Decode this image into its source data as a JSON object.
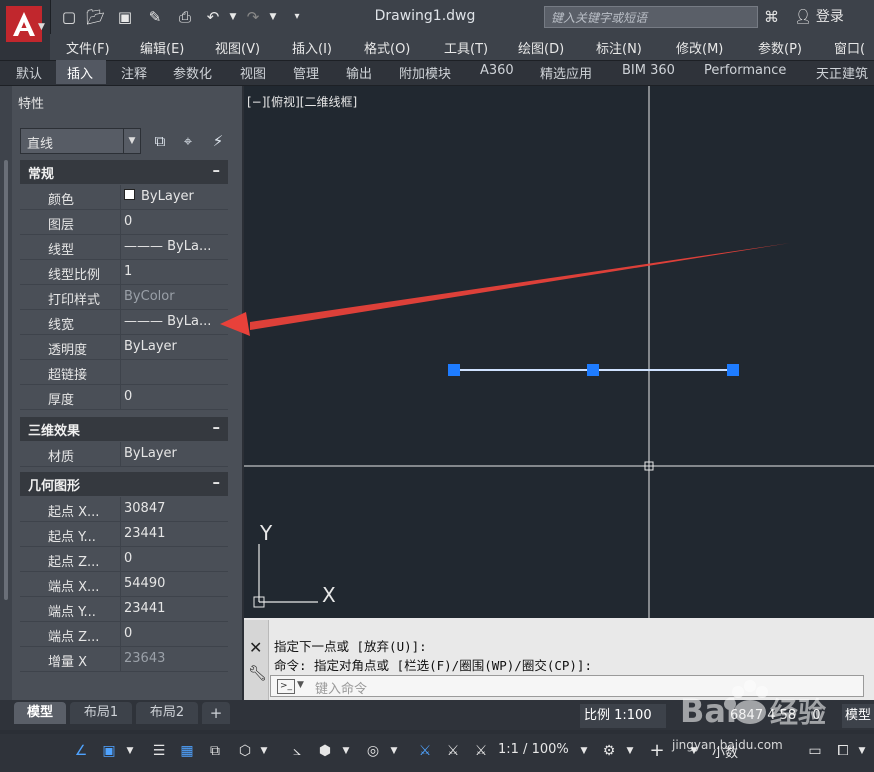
{
  "app": {
    "document_title": "Drawing1.dwg",
    "search_placeholder": "键入关键字或短语",
    "login_label": "登录"
  },
  "menu": [
    "文件(F)",
    "编辑(E)",
    "视图(V)",
    "插入(I)",
    "格式(O)",
    "工具(T)",
    "绘图(D)",
    "标注(N)",
    "修改(M)",
    "参数(P)",
    "窗口("
  ],
  "ribbon_tabs": [
    "默认",
    "插入",
    "注释",
    "参数化",
    "视图",
    "管理",
    "输出",
    "附加模块",
    "A360",
    "精选应用",
    "BIM 360",
    "Performance",
    "天正建筑"
  ],
  "ribbon_active": "插入",
  "properties": {
    "title": "特性",
    "object_type": "直线",
    "sections": [
      {
        "title": "常规",
        "collapse": "–",
        "rows": [
          {
            "key": "颜色",
            "value": "ByLayer",
            "swatch": "#ffffff"
          },
          {
            "key": "图层",
            "value": "0"
          },
          {
            "key": "线型",
            "value": "——— ByLa..."
          },
          {
            "key": "线型比例",
            "value": "1"
          },
          {
            "key": "打印样式",
            "value": "ByColor",
            "dim": true
          },
          {
            "key": "线宽",
            "value": "——— ByLa..."
          },
          {
            "key": "透明度",
            "value": "ByLayer"
          },
          {
            "key": "超链接",
            "value": ""
          },
          {
            "key": "厚度",
            "value": "0"
          }
        ]
      },
      {
        "title": "三维效果",
        "collapse": "–",
        "rows": [
          {
            "key": "材质",
            "value": "ByLayer"
          }
        ]
      },
      {
        "title": "几何图形",
        "collapse": "–",
        "rows": [
          {
            "key": "起点 X...",
            "value": "30847"
          },
          {
            "key": "起点 Y...",
            "value": "23441"
          },
          {
            "key": "起点 Z...",
            "value": "0"
          },
          {
            "key": "端点 X...",
            "value": "54490"
          },
          {
            "key": "端点 Y...",
            "value": "23441"
          },
          {
            "key": "端点 Z...",
            "value": "0"
          },
          {
            "key": "增量 X",
            "value": "23643",
            "dim": true
          }
        ]
      }
    ]
  },
  "viewport": {
    "label": "[−][俯视][二维线框]",
    "ucs_x": "X",
    "ucs_y": "Y"
  },
  "command": {
    "line1": "指定下一点或 [放弃(U)]:",
    "line2": "命令: 指定对角点或 [栏选(F)/圈围(WP)/圈交(CP)]:",
    "placeholder": "键入命令"
  },
  "layouts": [
    "模型",
    "布局1",
    "布局2"
  ],
  "layouts_add": "+",
  "status": {
    "scale": "比例 1:100",
    "coords": "6847 4 58",
    "coords_tail": "0",
    "model": "模型",
    "anno_scale": "1:1 / 100%",
    "units": "小数"
  },
  "watermark": {
    "text": "jingyan.baidu.com"
  },
  "colors": {
    "accent": "#4fa3ff",
    "arrow": "#e8413a",
    "grip": "#1e7cff",
    "viewport_bg": "#212830"
  }
}
